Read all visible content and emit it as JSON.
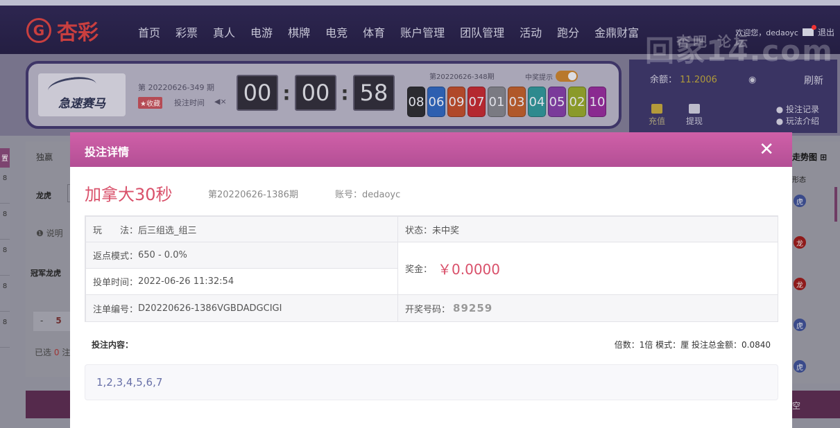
{
  "brand": {
    "logo_glyph": "G",
    "name": "杏彩"
  },
  "nav": [
    "首页",
    "彩票",
    "真人",
    "电游",
    "棋牌",
    "电竞",
    "体育",
    "账户管理",
    "团队管理",
    "活动",
    "跑分",
    "金鼎财富"
  ],
  "user": {
    "welcome": "欢迎您，dedaoyc",
    "logout": "退出"
  },
  "game": {
    "logo_text": "急速赛马",
    "current_issue": "第 20220626-349 期",
    "favorite": "★收藏",
    "bet_time": "投注时间",
    "sound_icon": "◀×",
    "countdown": [
      "00",
      "00",
      "58"
    ],
    "prev_issue": "第20220626-348期",
    "prize_hint": "中奖提示",
    "balls": [
      {
        "n": "08",
        "color": "#2b2b30"
      },
      {
        "n": "06",
        "color": "#2d5fb0"
      },
      {
        "n": "09",
        "color": "#b0482a"
      },
      {
        "n": "07",
        "color": "#b42830"
      },
      {
        "n": "01",
        "color": "#7a7a82"
      },
      {
        "n": "03",
        "color": "#b0582a"
      },
      {
        "n": "04",
        "color": "#2e8a8e"
      },
      {
        "n": "05",
        "color": "#7a3a9a"
      },
      {
        "n": "02",
        "color": "#8a9a2a"
      },
      {
        "n": "10",
        "color": "#8a2a90"
      }
    ]
  },
  "account": {
    "balance_label": "余额：",
    "balance_value": "11.2006",
    "refresh": "刷新",
    "deposit": "充值",
    "withdraw": "提现",
    "bet_record": "● 投注记录",
    "rules": "● 玩法介绍"
  },
  "watermark": {
    "top": "杏吧 论坛",
    "main": "回家14.com"
  },
  "background": {
    "left_tab_head": "置",
    "left_tab_items": [
      "8",
      "8",
      "8",
      "8",
      "8"
    ],
    "tab_duying": "独赢",
    "row_longhu": "龙虎",
    "info": "❶ 说明",
    "champion": "冠军龙虎",
    "minus": "-",
    "minus_num": "5",
    "selected_prefix": "已选",
    "selected_count": "0",
    "selected_suffix": "注",
    "trend_title": "走势图 ⊞",
    "trend_sub": "形态",
    "trend_marks": [
      "虎",
      "龙",
      "龙",
      "虎",
      "虎"
    ],
    "bottom_right": "空"
  },
  "modal": {
    "title": "投注详情",
    "close": "✕",
    "lottery_name": "加拿大30秒",
    "issue": "第20220626-1386期",
    "account": "账号：dedaoyc",
    "play_label": "玩　　法：",
    "play_value": "后三组选_组三",
    "status_label": "状态：",
    "status_value": "未中奖",
    "rebate_label": "返点模式：",
    "rebate_value": "650 - 0.0%",
    "prize_label": "奖金：",
    "prize_value": "￥0.0000",
    "time_label": "投单时间：",
    "time_value": "2022-06-26 11:32:54",
    "order_label": "注单编号：",
    "order_value": "D20220626-1386VGBDADGCIGI",
    "draw_label": "开奖号码：",
    "draw_value": "89259",
    "content_label": "投注内容：",
    "meta": "倍数：1倍  模式：厘  投注总金额：0.0840",
    "content": "1,2,3,4,5,6,7"
  }
}
